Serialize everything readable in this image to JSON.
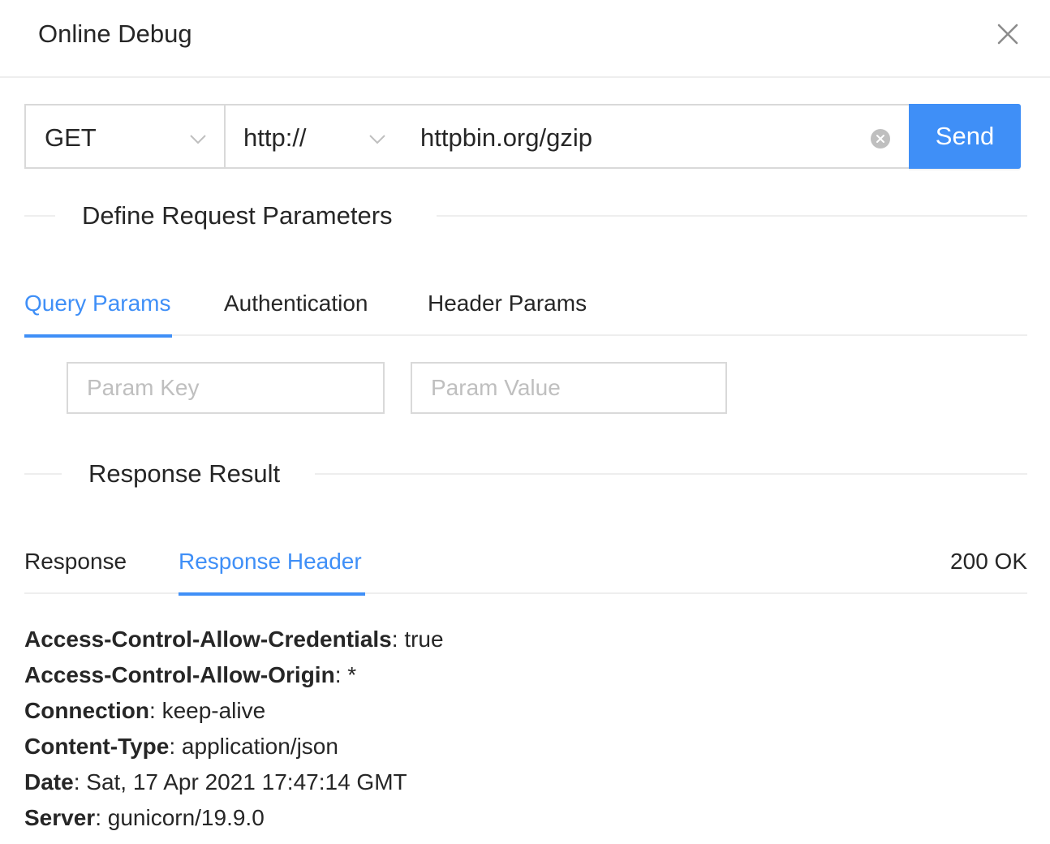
{
  "modal": {
    "title": "Online Debug"
  },
  "request": {
    "method": "GET",
    "scheme": "http://",
    "url": "httpbin.org/gzip",
    "send_label": "Send"
  },
  "params_section": {
    "title": "Define Request Parameters",
    "tabs": [
      {
        "label": "Query Params",
        "active": true
      },
      {
        "label": "Authentication",
        "active": false
      },
      {
        "label": "Header Params",
        "active": false
      }
    ],
    "key_placeholder": "Param Key",
    "value_placeholder": "Param Value"
  },
  "response_section": {
    "title": "Response Result",
    "tabs": [
      {
        "label": "Response",
        "active": false
      },
      {
        "label": "Response Header",
        "active": true
      }
    ],
    "status": "200 OK",
    "headers": [
      {
        "key": "Access-Control-Allow-Credentials",
        "value": "true"
      },
      {
        "key": "Access-Control-Allow-Origin",
        "value": "*"
      },
      {
        "key": "Connection",
        "value": "keep-alive"
      },
      {
        "key": "Content-Type",
        "value": "application/json"
      },
      {
        "key": "Date",
        "value": "Sat, 17 Apr 2021 17:47:14 GMT"
      },
      {
        "key": "Server",
        "value": "gunicorn/19.9.0"
      }
    ]
  },
  "colors": {
    "accent": "#3f8ff7",
    "border": "#d9d9d9",
    "text": "#262626",
    "placeholder": "#bfbfbf"
  },
  "icons": {
    "close": "close-icon",
    "chevron": "chevron-down-icon",
    "clear": "clear-circle-icon"
  }
}
